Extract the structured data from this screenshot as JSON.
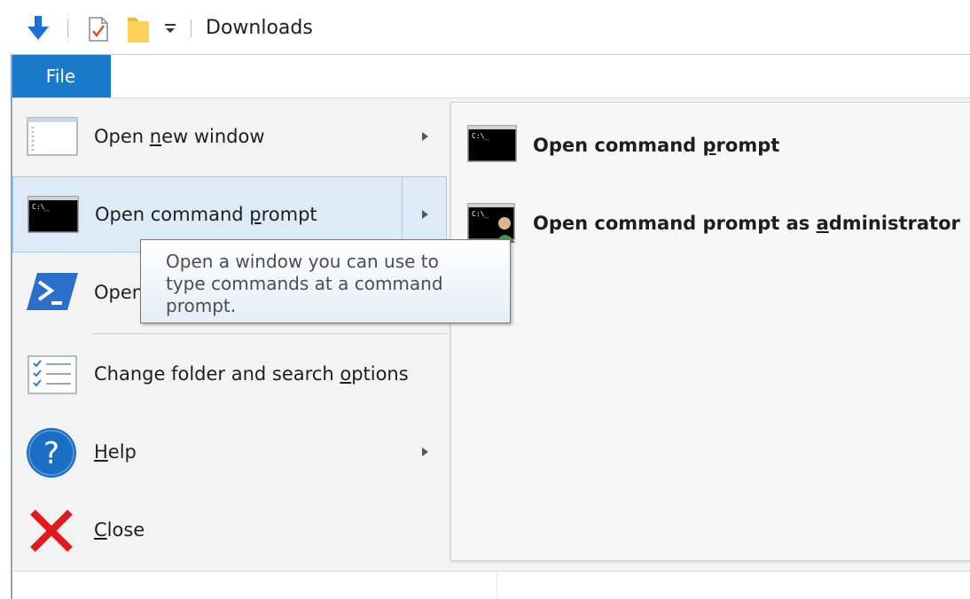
{
  "titlebar": {
    "title": "Downloads",
    "icons": [
      "down-arrow-icon",
      "properties-icon",
      "new-folder-icon",
      "customize-dropdown-icon"
    ]
  },
  "ribbon": {
    "file_tab": "File"
  },
  "file_menu": {
    "items": [
      {
        "pre": "Open ",
        "key": "n",
        "post": "ew window",
        "icon": "new-window-icon",
        "has_submenu": true
      },
      {
        "pre": "Open command ",
        "key": "p",
        "post": "rompt",
        "icon": "command-prompt-icon",
        "has_submenu": true,
        "highlighted": true
      },
      {
        "visible_text": "Open",
        "icon": "powershell-icon"
      },
      {
        "pre": "Change folder and search ",
        "key": "o",
        "post": "ptions",
        "icon": "folder-options-icon"
      },
      {
        "pre": "",
        "key": "H",
        "post": "elp",
        "icon": "help-icon",
        "has_submenu": true
      },
      {
        "pre": "",
        "key": "C",
        "post": "lose",
        "icon": "close-icon"
      }
    ]
  },
  "submenu": {
    "items": [
      {
        "pre": "Open command ",
        "key": "p",
        "post": "rompt",
        "icon": "command-prompt-icon"
      },
      {
        "pre": "Open command prompt as ",
        "key": "a",
        "post": "dministrator",
        "icon": "command-prompt-admin-icon"
      }
    ]
  },
  "tooltip": {
    "lines": [
      "Open a window you can use to",
      "type commands at a command",
      "prompt."
    ]
  },
  "colors": {
    "accent": "#1979ca",
    "highlight": "#ddeaf7",
    "highlight_border": "#a5c8eb",
    "menu_bg": "#f3f3f3"
  }
}
